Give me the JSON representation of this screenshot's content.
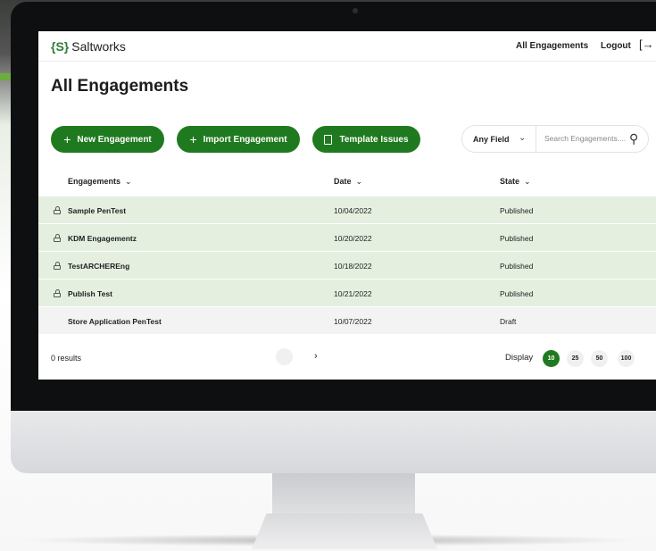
{
  "app": {
    "logo_mark": "{S}",
    "logo_name": "Saltworks",
    "accent_color": "#1f7a1f"
  },
  "nav": {
    "all_engagements": "All Engagements",
    "logout": "Logout",
    "logout_icon": "→"
  },
  "page": {
    "title": "All Engagements"
  },
  "actions": {
    "new_engagement": "New Engagement",
    "import_engagement": "Import Engagement",
    "template_issues": "Template Issues",
    "plus_icon": "+"
  },
  "search": {
    "field_value": "Any Field",
    "placeholder": "Search Engagements...."
  },
  "table": {
    "headers": {
      "engagements": "Engagements",
      "date": "Date",
      "state": "State"
    },
    "rows": [
      {
        "name": "Sample PenTest",
        "date": "10/04/2022",
        "state": "Published",
        "locked": true
      },
      {
        "name": "KDM Engagementz",
        "date": "10/20/2022",
        "state": "Published",
        "locked": true
      },
      {
        "name": "TestARCHEREng",
        "date": "10/18/2022",
        "state": "Published",
        "locked": true
      },
      {
        "name": "Publish Test",
        "date": "10/21/2022",
        "state": "Published",
        "locked": true
      },
      {
        "name": "Store Application PenTest",
        "date": "10/07/2022",
        "state": "Draft",
        "locked": false
      }
    ]
  },
  "footer": {
    "results": "0 results",
    "next": "›",
    "display_label": "Display",
    "page_sizes": [
      "10",
      "25",
      "50",
      "100"
    ],
    "selected_page_size": "10"
  }
}
